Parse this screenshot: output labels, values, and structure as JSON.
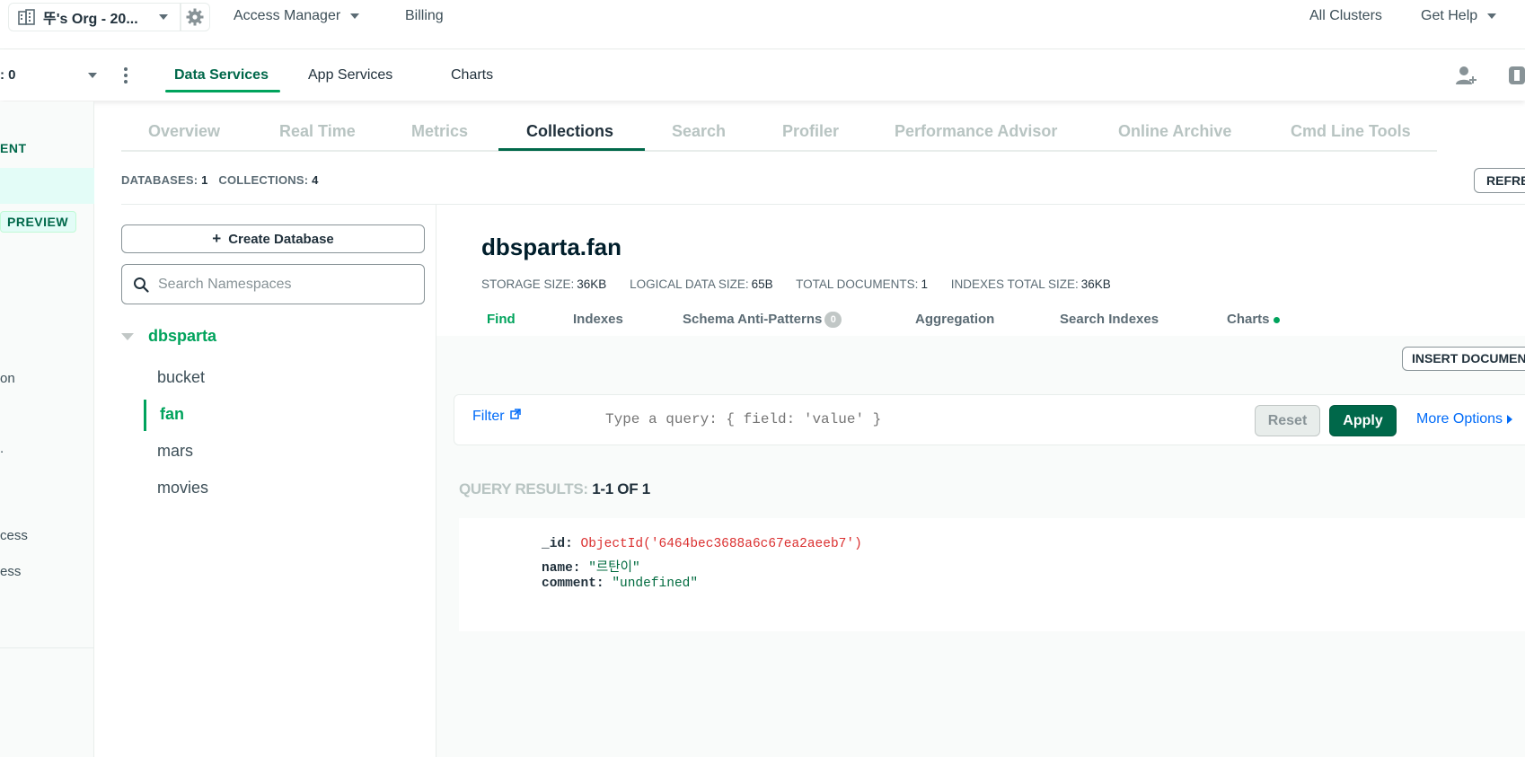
{
  "topbar": {
    "org_name": "뚜's Org - 20...",
    "access_manager": "Access Manager",
    "billing": "Billing",
    "all_clusters": "All Clusters",
    "get_help": "Get Help"
  },
  "project_bar": {
    "project_name": ": 0",
    "tabs": [
      "Data Services",
      "App Services",
      "Charts"
    ],
    "active_tab": "Data Services"
  },
  "left_rail": {
    "section_label": "ENT",
    "preview_badge": "PREVIEW",
    "items": [
      "on",
      ".",
      "cess",
      "ess"
    ]
  },
  "subtabs": [
    "Overview",
    "Real Time",
    "Metrics",
    "Collections",
    "Search",
    "Profiler",
    "Performance Advisor",
    "Online Archive",
    "Cmd Line Tools"
  ],
  "active_subtab": "Collections",
  "counts": {
    "databases_label": "DATABASES:",
    "databases": "1",
    "collections_label": "COLLECTIONS:",
    "collections": "4"
  },
  "refresh_label": "REFRESH",
  "namespace": {
    "create_db_label": "Create Database",
    "search_placeholder": "Search Namespaces",
    "database": "dbsparta",
    "collections": [
      "bucket",
      "fan",
      "mars",
      "movies"
    ],
    "active_collection": "fan"
  },
  "collection": {
    "title": "dbsparta.fan",
    "stats": {
      "storage_label": "STORAGE SIZE:",
      "storage": "36KB",
      "logical_label": "LOGICAL DATA SIZE:",
      "logical": "65B",
      "docs_label": "TOTAL DOCUMENTS:",
      "docs": "1",
      "indexes_label": "INDEXES TOTAL SIZE:",
      "indexes": "36KB"
    },
    "tabs": [
      "Find",
      "Indexes",
      "Schema Anti-Patterns",
      "Aggregation",
      "Search Indexes",
      "Charts"
    ],
    "active_tab": "Find",
    "anti_patterns_count": "0"
  },
  "insert_document_label": "INSERT DOCUMENT",
  "filter": {
    "label": "Filter",
    "placeholder": "Type a query: { field: 'value' }",
    "reset": "Reset",
    "apply": "Apply",
    "more_options": "More Options"
  },
  "results": {
    "label": "QUERY RESULTS:",
    "range": "1-1 OF 1"
  },
  "document": {
    "fields": [
      {
        "key": "_id:",
        "value": "ObjectId('6464bec3688a6c67ea2aeeb7')"
      },
      {
        "key": "name:",
        "value": "\"르탄이\""
      },
      {
        "key": "comment:",
        "value": "\"undefined\""
      }
    ]
  },
  "colors": {
    "green_primary": "#00a35c",
    "green_dark": "#00684a",
    "blue_link": "#016bf8",
    "oid_red": "#db3030"
  }
}
